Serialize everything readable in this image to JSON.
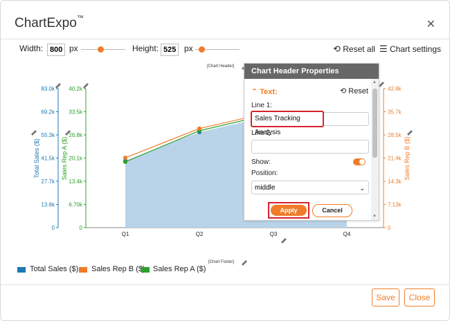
{
  "app": {
    "name": "ChartExpo",
    "tm": "™"
  },
  "toolbar": {
    "width_label": "Width:",
    "width_value": "800",
    "width_unit": "px",
    "height_label": "Height:",
    "height_value": "525",
    "height_unit": "px",
    "reset_all": "Reset all",
    "chart_settings": "Chart settings"
  },
  "chart": {
    "header_tag": "[Chart Header]",
    "footer_tag": "[Chart Footer]",
    "categories": [
      "Q1",
      "Q2",
      "Q3",
      "Q4"
    ]
  },
  "chart_data": {
    "type": "area",
    "categories": [
      "Q1",
      "Q2",
      "Q3",
      "Q4"
    ],
    "axes": {
      "total_sales": {
        "label": "Total Sales ($)",
        "ticks": [
          "0",
          "13.8k",
          "27.7k",
          "41.5k",
          "55.3k",
          "69.2k",
          "83.0k"
        ],
        "color": "#1f77b4"
      },
      "rep_a": {
        "label": "Sales Rep A ($)",
        "ticks": [
          "0",
          "6.70k",
          "13.4k",
          "20.1k",
          "26.8k",
          "33.5k",
          "40.2k"
        ],
        "color": "#2ca02c"
      },
      "rep_b": {
        "label": "Sales Rep B ($)",
        "ticks": [
          "0",
          "7.13k",
          "14.3k",
          "21.4k",
          "28.5k",
          "35.7k",
          "42.8k"
        ],
        "color": "#f07c28"
      }
    },
    "series": [
      {
        "name": "Total Sales ($)",
        "values": [
          40000,
          57000,
          67000,
          71000
        ],
        "color": "#1f77b4"
      },
      {
        "name": "Sales Rep A ($)",
        "values": [
          19000,
          28000,
          33000,
          35000
        ],
        "color": "#2ca02c"
      },
      {
        "name": "Sales Rep B ($)",
        "values": [
          21500,
          30500,
          35700,
          37800
        ],
        "color": "#f07c28"
      }
    ]
  },
  "legend": {
    "items": [
      "Total Sales ($)",
      "Sales Rep B ($)",
      "Sales Rep A ($)"
    ]
  },
  "panel": {
    "title": "Chart Header Properties",
    "section": "Text:",
    "reset": "Reset",
    "line1_label": "Line 1:",
    "line1_value": "Sales Tracking Analysis",
    "line2_label": "Line 2:",
    "line2_value": "",
    "show_label": "Show:",
    "position_label": "Position:",
    "position_value": "middle",
    "apply": "Apply",
    "cancel": "Cancel"
  },
  "footer": {
    "save": "Save",
    "close": "Close"
  },
  "colors": {
    "accent": "#f07c28",
    "highlight": "#d6212b",
    "area": "#b9d3e8"
  }
}
